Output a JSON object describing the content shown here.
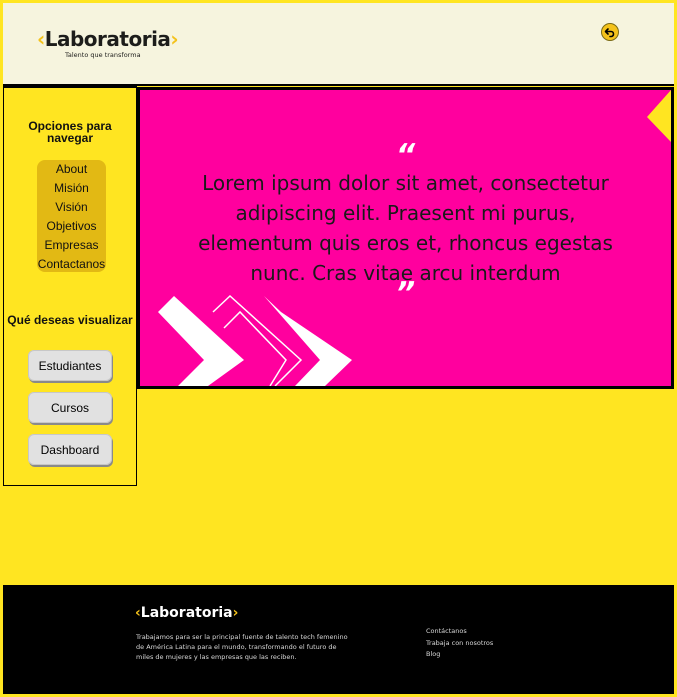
{
  "header": {
    "logo_text": "Laboratoria",
    "logo_chevron_left": "‹",
    "logo_chevron_right": "›",
    "tagline": "Talento que transforma",
    "back_icon": "undo-arrow-icon"
  },
  "sidebar": {
    "nav_heading": "Opciones para navegar",
    "nav_items": [
      "About",
      "Misión",
      "Visión",
      "Objetivos",
      "Empresas",
      "Contactanos"
    ],
    "view_heading": "Qué deseas visualizar",
    "view_buttons": [
      "Estudiantes",
      "Cursos",
      "Dashboard"
    ]
  },
  "hero": {
    "open_quote": "“",
    "quote": "Lorem ipsum dolor sit amet, consectetur adipiscing elit. Praesent mi purus, elementum quis eros et, rhoncus egestas nunc. Cras vitae arcu interdum",
    "close_quote": "”",
    "background_color": "#ff009e"
  },
  "footer": {
    "logo_text": "Laboratoria",
    "description": "Trabajamos para ser la principal fuente de talento tech femenino de América Latina para el mundo, transformando el futuro de miles de mujeres y las empresas que las reciben.",
    "links": [
      "Contáctanos",
      "Trabaja con nosotros",
      "Blog"
    ]
  },
  "colors": {
    "brand_yellow": "#ffe521",
    "brand_magenta": "#ff009e",
    "header_bg": "#f6f4de"
  }
}
